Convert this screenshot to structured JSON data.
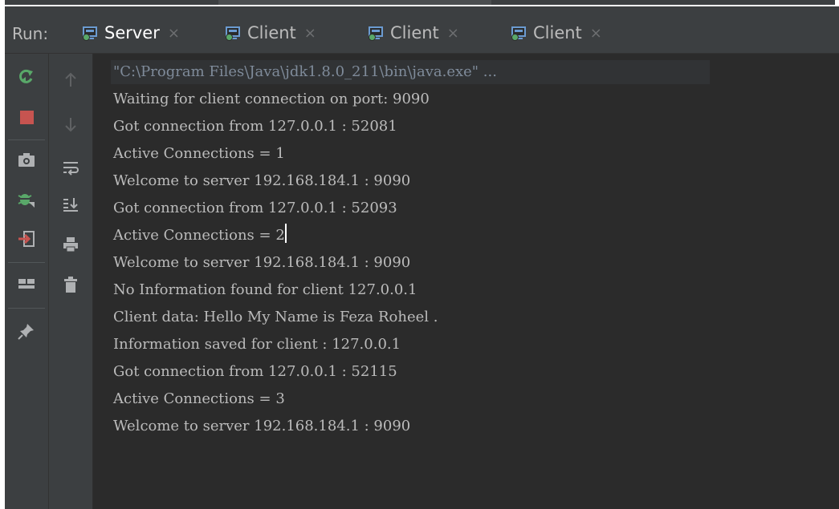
{
  "run_label": "Run:",
  "tabs": [
    {
      "label": "Server",
      "close": "×",
      "active": true
    },
    {
      "label": "Client",
      "close": "×",
      "active": false
    },
    {
      "label": "Client",
      "close": "×",
      "active": false
    },
    {
      "label": "Client",
      "close": "×",
      "active": false
    }
  ],
  "left_toolbar": [
    "rerun-icon",
    "stop-icon",
    "camera-icon",
    "debug-icon",
    "exit-icon",
    "layout-icon",
    "pin-icon"
  ],
  "second_toolbar": [
    "up-arrow-icon",
    "down-arrow-icon",
    "soft-wrap-icon",
    "scroll-to-end-icon",
    "print-icon",
    "trash-icon"
  ],
  "console": {
    "command": "\"C:\\Program Files\\Java\\jdk1.8.0_211\\bin\\java.exe\" ...",
    "lines": [
      "Waiting for client connection on port: 9090",
      "Got connection from 127.0.0.1 : 52081",
      "Active Connections = 1",
      "Welcome to server 192.168.184.1 : 9090",
      "Got connection from 127.0.0.1 : 52093",
      "Active Connections = 2",
      "Welcome to server 192.168.184.1 : 9090",
      "No Information found for client 127.0.0.1",
      "Client data: Hello My Name is Feza Roheel .",
      "Information saved for client : 127.0.0.1",
      "Got connection from 127.0.0.1 : 52115",
      "Active Connections = 3",
      "Welcome to server 192.168.184.1 : 9090"
    ]
  },
  "colors": {
    "console_bg": "#2b2b2b",
    "toolbar_bg": "#3c3f41",
    "text": "#bbbbbb",
    "command_text": "#7f8b9a",
    "rerun": "#59a869",
    "stop": "#c75450"
  }
}
